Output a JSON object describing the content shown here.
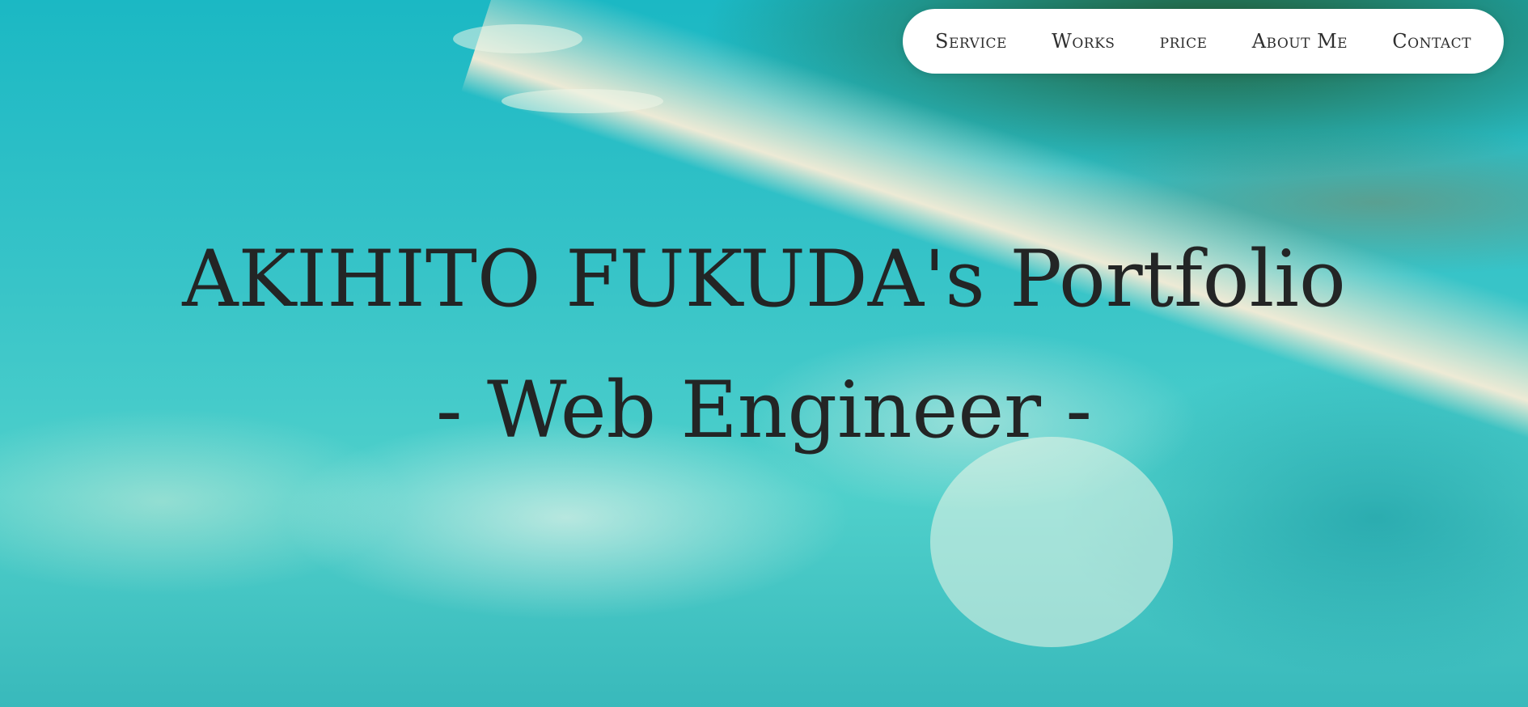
{
  "nav": {
    "items": [
      {
        "label": "Service"
      },
      {
        "label": "Works"
      },
      {
        "label": "price"
      },
      {
        "label": "About Me"
      },
      {
        "label": "Contact"
      }
    ]
  },
  "hero": {
    "title": "AKIHITO FUKUDA's Portfolio",
    "subtitle": "- Web Engineer -"
  }
}
